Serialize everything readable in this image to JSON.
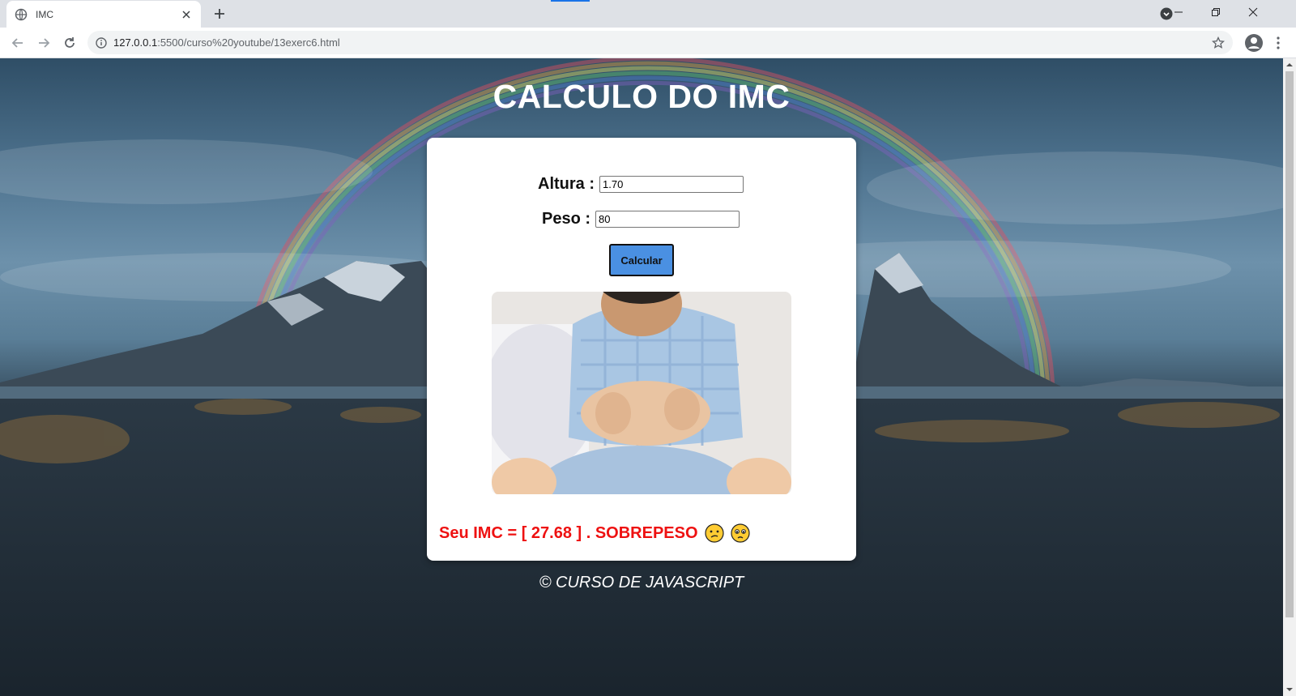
{
  "browser": {
    "tab_title": "IMC",
    "url_host": "127.0.0.1",
    "url_rest": ":5500/curso%20youtube/13exerc6.html",
    "icons": [
      "globe-icon",
      "close-icon",
      "plus-icon",
      "back-icon",
      "forward-icon",
      "reload-icon",
      "info-icon",
      "star-icon",
      "profile-icon",
      "menu-icon",
      "minimize-icon",
      "restore-icon",
      "window-close-icon"
    ]
  },
  "page": {
    "title": "CALCULO DO IMC",
    "form": {
      "altura_label": "Altura :",
      "altura_value": "1.70",
      "peso_label": "Peso :",
      "peso_value": "80",
      "button_label": "Calcular"
    },
    "result_text": "Seu IMC = [ 27.68 ] . SOBREPESO",
    "footer": "© CURSO DE JAVASCRIPT"
  },
  "colors": {
    "result": "#ee1111",
    "button": "#4a90e2",
    "title": "#ffffff"
  }
}
